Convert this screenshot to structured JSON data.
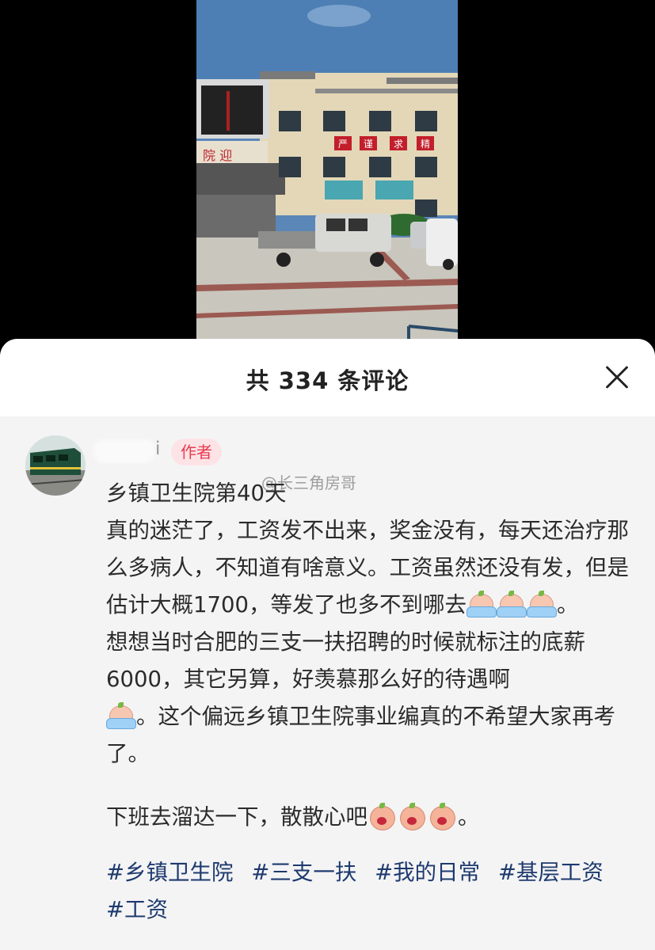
{
  "header": {
    "title": "共 334 条评论"
  },
  "photo": {
    "sign_chars": [
      "严",
      "谨",
      "求",
      "精"
    ],
    "left_sign": "院 迎"
  },
  "comment": {
    "username_suffix": "i",
    "author_badge": "作者",
    "watermark": "@长三角房哥",
    "paragraphs": [
      "乡镇卫生院第40天",
      "真的迷茫了，工资发不出来，奖金没有，每天还治疗那么多病人，不知道有啥意义。工资虽然还没有发，但是估计大概1700，等发了也多不到哪去",
      "。",
      "想想当时合肥的三支一扶招聘的时候就标注的底薪6000，其它另算，好羡慕那么好的待遇啊",
      "。这个偏远乡镇卫生院事业编真的不希望大家再考了。",
      "下班去溜达一下，散散心吧",
      "。"
    ],
    "tags": [
      "#乡镇卫生院",
      "#三支一扶",
      "#我的日常",
      "#基层工资",
      "#工资"
    ]
  },
  "icons": {
    "close": "close-icon",
    "cry_emoji": "crying-emoji-icon",
    "mad_emoji": "shouting-emoji-icon"
  }
}
